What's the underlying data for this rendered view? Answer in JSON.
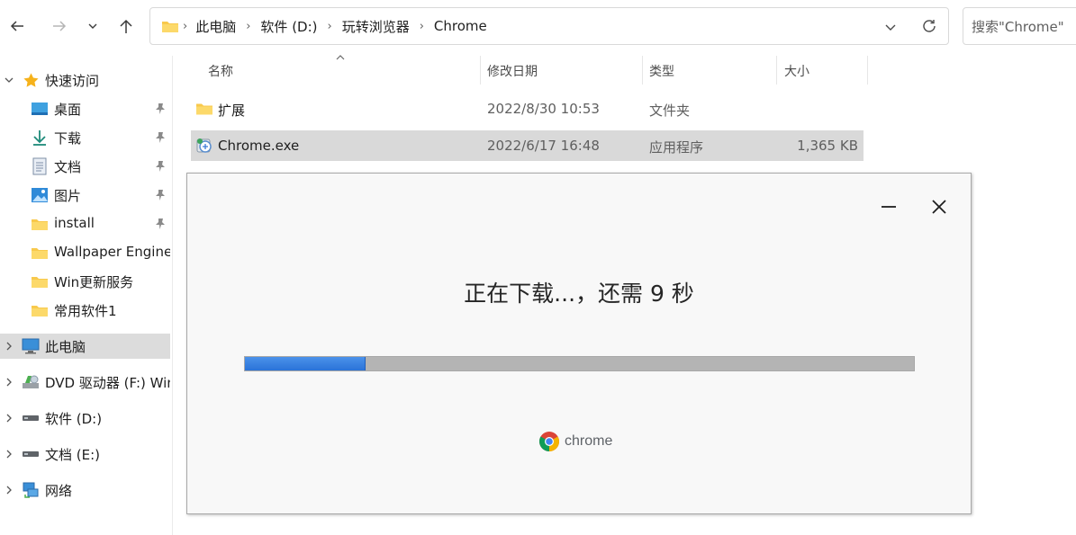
{
  "toolbar": {
    "breadcrumbs": [
      "此电脑",
      "软件 (D:)",
      "玩转浏览器",
      "Chrome"
    ],
    "search_placeholder": "搜索\"Chrome\"",
    "icons": {
      "back": "arrow-left-icon",
      "forward": "arrow-right-icon",
      "recent": "chevron-down-icon",
      "up": "arrow-up-icon",
      "folder": "folder-icon",
      "dropdown": "chevron-down-icon",
      "refresh": "refresh-icon"
    }
  },
  "sidebar": {
    "items": [
      {
        "label": "快速访问",
        "icon": "star-icon",
        "pinned": false
      },
      {
        "label": "桌面",
        "icon": "desktop-icon",
        "pinned": true
      },
      {
        "label": "下载",
        "icon": "download-icon",
        "pinned": true
      },
      {
        "label": "文档",
        "icon": "document-icon",
        "pinned": true
      },
      {
        "label": "图片",
        "icon": "pictures-icon",
        "pinned": true
      },
      {
        "label": "install",
        "icon": "folder-icon",
        "pinned": true
      },
      {
        "label": "Wallpaper Engine",
        "icon": "folder-icon",
        "pinned": false
      },
      {
        "label": "Win更新服务",
        "icon": "folder-icon",
        "pinned": false
      },
      {
        "label": "常用软件1",
        "icon": "folder-icon",
        "pinned": false
      },
      {
        "label": "此电脑",
        "icon": "computer-icon",
        "selected": true
      },
      {
        "label": "DVD 驱动器 (F:) Win",
        "icon": "dvd-drive-icon"
      },
      {
        "label": "软件 (D:)",
        "icon": "drive-icon"
      },
      {
        "label": "文档 (E:)",
        "icon": "drive-icon"
      },
      {
        "label": "网络",
        "icon": "network-icon"
      }
    ]
  },
  "columns": {
    "name": "名称",
    "modified": "修改日期",
    "type": "类型",
    "size": "大小"
  },
  "files": [
    {
      "name": "扩展",
      "modified": "2022/8/30 10:53",
      "type": "文件夹",
      "size": "",
      "icon": "folder-icon"
    },
    {
      "name": "Chrome.exe",
      "modified": "2022/6/17 16:48",
      "type": "应用程序",
      "size": "1,365 KB",
      "icon": "installer-icon",
      "selected": true
    }
  ],
  "installer": {
    "status": "正在下载...，还需 9 秒",
    "progress": 0.18,
    "brand": "chrome",
    "colors": {
      "progress_fill": "#2f7be0",
      "track": "#b4b4b4"
    },
    "icons": {
      "minimize": "minimize-icon",
      "close": "close-icon",
      "logo": "chrome-logo-icon"
    }
  }
}
